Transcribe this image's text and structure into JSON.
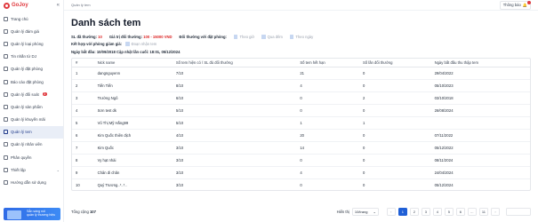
{
  "app": {
    "brand": "GoJoy"
  },
  "sidebar": {
    "items": [
      {
        "label": "Trang chủ",
        "icon": "home-icon"
      },
      {
        "label": "Quản lý đám giá",
        "icon": "auction-icon"
      },
      {
        "label": "Quản lý loại phòng",
        "icon": "room-type-icon"
      },
      {
        "label": "Tin nhắn từ DJ",
        "icon": "message-icon"
      },
      {
        "label": "Quản lý đặt phòng",
        "icon": "booking-icon"
      },
      {
        "label": "Báo cáo đặt phòng",
        "icon": "report-icon"
      },
      {
        "label": "Quản lý đối soát",
        "icon": "reconcile-icon",
        "badge": "3"
      },
      {
        "label": "Quản lý sản phẩm",
        "icon": "product-icon"
      },
      {
        "label": "Quản lý khuyến mãi",
        "icon": "promo-icon"
      },
      {
        "label": "Quản lý tem",
        "icon": "stamp-icon",
        "active": true
      },
      {
        "label": "Quản lý nhân viên",
        "icon": "staff-icon"
      },
      {
        "label": "Phân quyền",
        "icon": "permission-icon"
      },
      {
        "label": "Thiết lập",
        "icon": "settings-icon",
        "chevron": true
      },
      {
        "label": "Hướng dẫn sử dụng",
        "icon": "help-icon"
      }
    ],
    "promo_line1": "Sẵn sàng nói",
    "promo_line2": "quản lý thương hiệu"
  },
  "topbar": {
    "breadcrumb": "Quản lý tem",
    "notify_label": "Thông báo"
  },
  "page": {
    "title": "Danh sách tem",
    "stat_redeemed_label": "SL đã thưởng:",
    "stat_redeemed_value": "10",
    "stat_value_label": "Giá trị đổi thưởng:",
    "stat_value_value": "100 - 15000 VND",
    "stat_method_label": "Đổi thưởng với đặt phòng:",
    "opt1": "Theo giờ",
    "opt2": "Qua đêm",
    "opt3": "Theo ngày",
    "combine_label": "Kết hợp với phòng giảm giá:",
    "combine_opt": "Đoạn nhận tem",
    "dates_text": "Ngày bắt đầu: 10/09/2018  Cập nhật lần cuối: 18:01, 05/12/2024"
  },
  "table": {
    "headers": [
      "#",
      "Nick name",
      "Số tem hiện có / SL đủ đổi thưởng",
      "Số tem hết hạn",
      "Số lần đổi thưởng",
      "Ngày bắt đầu thu thập tem"
    ],
    "rows": [
      [
        "1",
        "dangnguyenn",
        "7/10",
        "21",
        "0",
        "29/04/2022"
      ],
      [
        "2",
        "Tiến Tiến",
        "8/10",
        "4",
        "0",
        "05/10/2023"
      ],
      [
        "3",
        "Trường Ngô",
        "6/10",
        "0",
        "2",
        "03/10/2018"
      ],
      [
        "4",
        "Sơn test dk",
        "5/10",
        "0",
        "0",
        "26/08/2024"
      ],
      [
        "5",
        "Vũ Thị Mỹ Hằng99",
        "5/10",
        "1",
        "1",
        ""
      ],
      [
        "6",
        "Kim Quốc thiên địch",
        "4/10",
        "20",
        "0",
        "07/11/2022"
      ],
      [
        "7",
        "Kim Quốc",
        "3/10",
        "14",
        "0",
        "05/12/2022"
      ],
      [
        "8",
        "Vy hạt nhài",
        "3/10",
        "0",
        "0",
        "08/11/2024"
      ],
      [
        "9",
        "Chân đi chăn",
        "3/10",
        "4",
        "0",
        "24/04/2024"
      ],
      [
        "10",
        "Quý Trương..*..*..",
        "3/10",
        "0",
        "0",
        "05/12/2024"
      ]
    ]
  },
  "footer": {
    "total_label": "Tổng cộng",
    "total_value": "107",
    "per_page_label": "Hiển thị",
    "per_page_value": "10/trang",
    "pages": [
      "1",
      "2",
      "3",
      "4",
      "5",
      "6",
      "...",
      "11"
    ],
    "prev": "‹",
    "next": "›"
  }
}
